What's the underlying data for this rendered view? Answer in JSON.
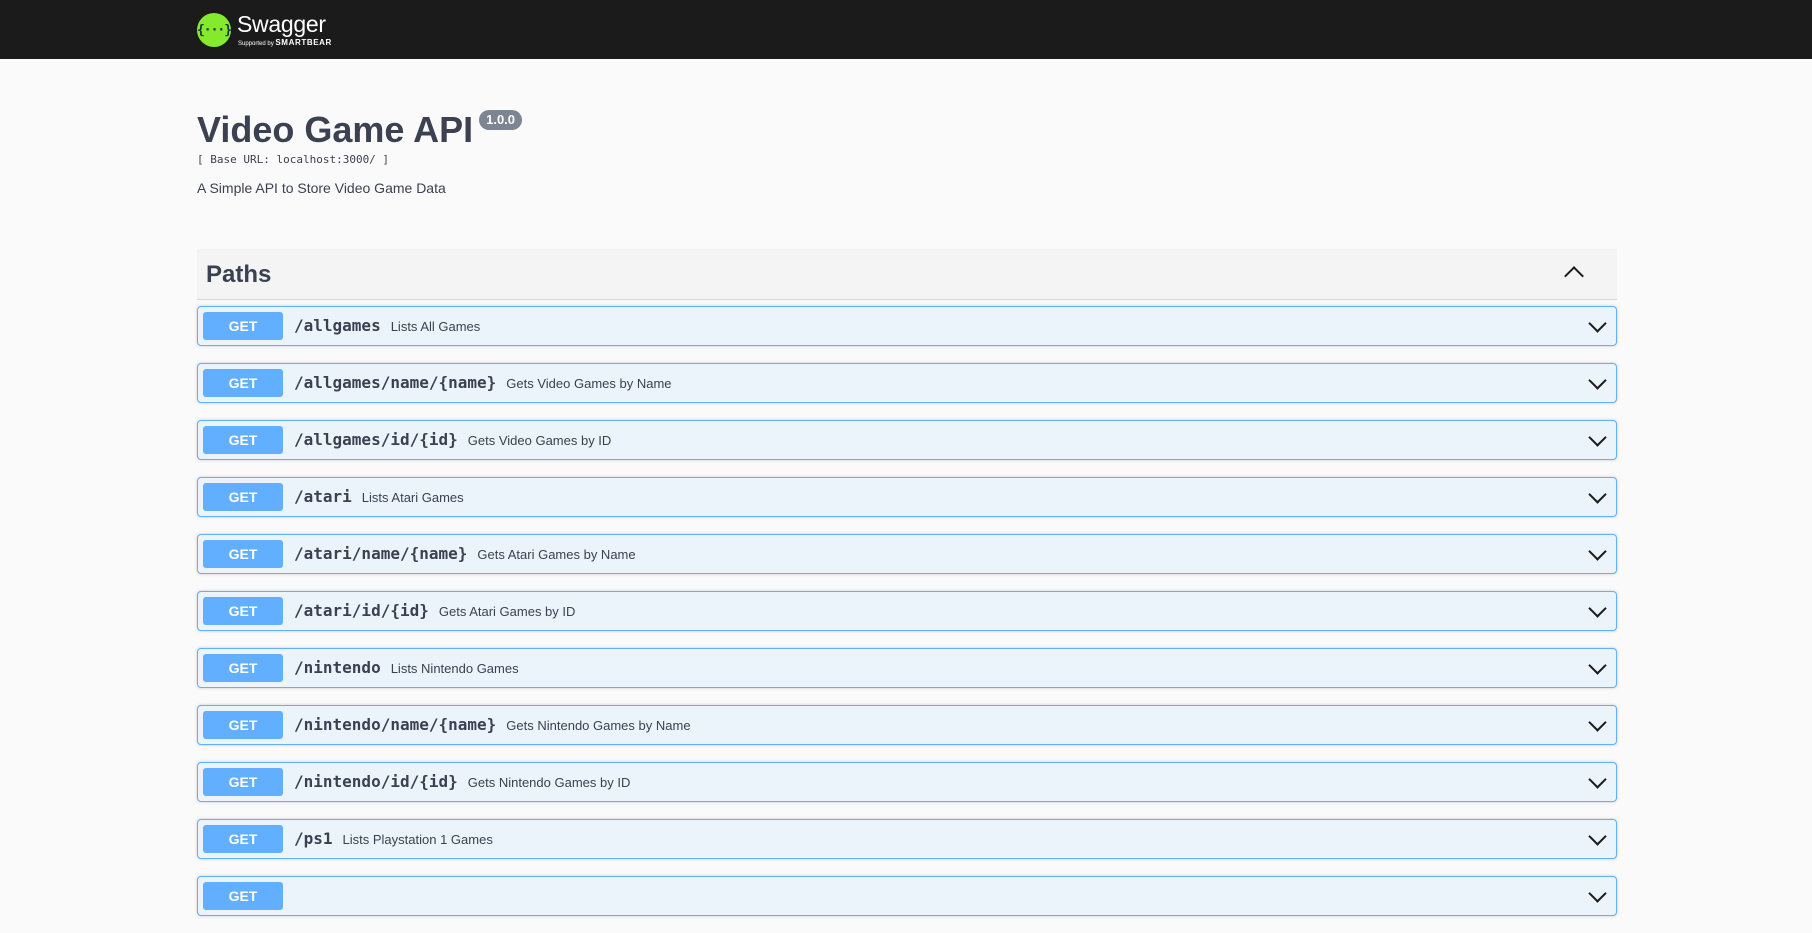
{
  "topbar": {
    "logo_icon": "swagger-braces-icon",
    "logo_glyph": "{···}",
    "brand_name": "Swagger",
    "brand_supported": "Supported by",
    "brand_company": "SMARTBEAR"
  },
  "info": {
    "title": "Video Game API",
    "version": "1.0.0",
    "base_url": "[ Base URL: localhost:3000/ ]",
    "description": "A Simple API to Store Video Game Data"
  },
  "paths": {
    "title": "Paths",
    "toggle_icon": "chevron-up-icon",
    "operations": [
      {
        "method": "GET",
        "path": "/allgames",
        "summary": "Lists All Games"
      },
      {
        "method": "GET",
        "path": "/allgames/name/{name}",
        "summary": "Gets Video Games by Name"
      },
      {
        "method": "GET",
        "path": "/allgames/id/{id}",
        "summary": "Gets Video Games by ID"
      },
      {
        "method": "GET",
        "path": "/atari",
        "summary": "Lists Atari Games"
      },
      {
        "method": "GET",
        "path": "/atari/name/{name}",
        "summary": "Gets Atari Games by Name"
      },
      {
        "method": "GET",
        "path": "/atari/id/{id}",
        "summary": "Gets Atari Games by ID"
      },
      {
        "method": "GET",
        "path": "/nintendo",
        "summary": "Lists Nintendo Games"
      },
      {
        "method": "GET",
        "path": "/nintendo/name/{name}",
        "summary": "Gets Nintendo Games by Name"
      },
      {
        "method": "GET",
        "path": "/nintendo/id/{id}",
        "summary": "Gets Nintendo Games by ID"
      },
      {
        "method": "GET",
        "path": "/ps1",
        "summary": "Lists Playstation 1 Games"
      },
      {
        "method": "GET",
        "path": "",
        "summary": ""
      }
    ]
  },
  "colors": {
    "topbar_bg": "#1b1b1b",
    "logo_green": "#85ea2d",
    "get_blue": "#61affe",
    "get_bg": "#ebf3fb",
    "text": "#3b4151"
  }
}
